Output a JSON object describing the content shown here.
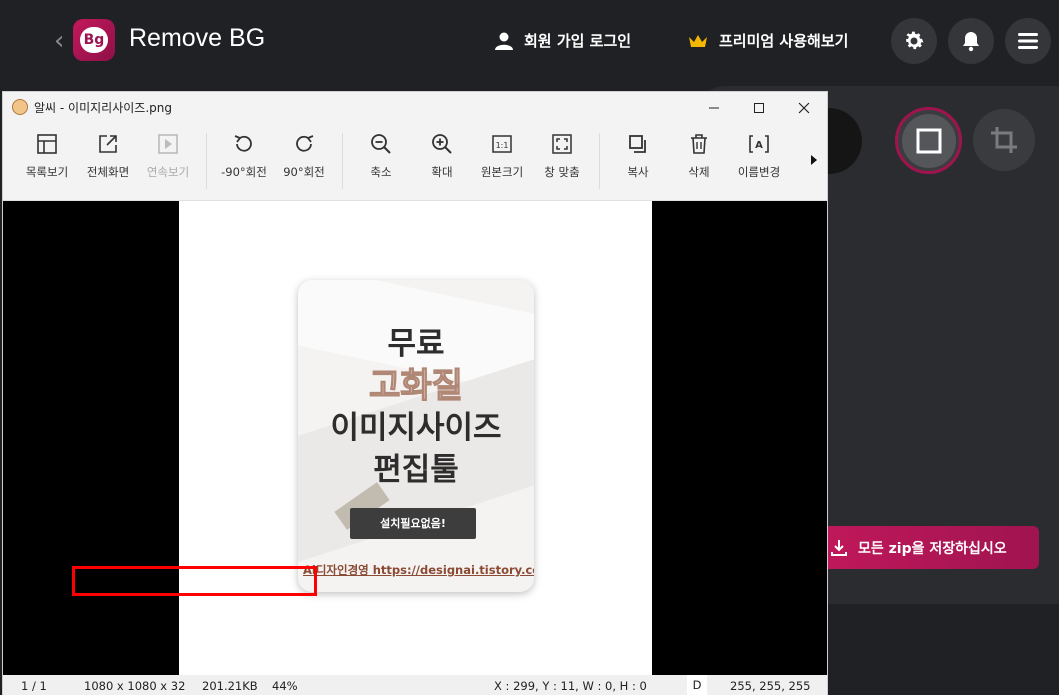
{
  "app": {
    "title": "Remove BG",
    "logo_text": "Bg",
    "login_label": "회원 가입 로그인",
    "premium_label": "프리미엄 사용해보기",
    "zip_button_label": "모든 zip을 저장하십시오",
    "colors": {
      "accent": "#c2185b",
      "background": "#202124",
      "panel": "#2b2c30",
      "premium_crown": "#f5b700"
    }
  },
  "viewer": {
    "window_title": "알씨 - 이미지리사이즈.png",
    "toolbar": [
      {
        "label": "목록보기",
        "icon": "list-view-icon",
        "enabled": true
      },
      {
        "label": "전체화면",
        "icon": "fullscreen-icon",
        "enabled": true
      },
      {
        "label": "연속보기",
        "icon": "slideshow-icon",
        "enabled": false
      },
      {
        "label": "-90°회전",
        "icon": "rotate-left-icon",
        "enabled": true
      },
      {
        "label": "90°회전",
        "icon": "rotate-right-icon",
        "enabled": true
      },
      {
        "label": "축소",
        "icon": "zoom-out-icon",
        "enabled": true
      },
      {
        "label": "확대",
        "icon": "zoom-in-icon",
        "enabled": true
      },
      {
        "label": "원본크기",
        "icon": "original-size-icon",
        "enabled": true
      },
      {
        "label": "창 맞춤",
        "icon": "fit-window-icon",
        "enabled": true
      },
      {
        "label": "복사",
        "icon": "copy-icon",
        "enabled": true
      },
      {
        "label": "삭제",
        "icon": "trash-icon",
        "enabled": true
      },
      {
        "label": "이름변경",
        "icon": "rename-icon",
        "enabled": true
      }
    ],
    "image": {
      "line1": "무료",
      "line2": "고화질",
      "line3": "이미지사이즈",
      "line4": "편집툴",
      "button": "설치필요없음!",
      "credit": "Ai디자인경영 https://designai.tistory.com"
    },
    "status": {
      "page": "1 / 1",
      "dimensions": "1080 x 1080 x 32",
      "filesize": "201.21KB",
      "zoom": "44%",
      "coords": "X : 299, Y : 11, W : 0, H : 0",
      "mode": "D",
      "color": "255, 255, 255"
    }
  }
}
